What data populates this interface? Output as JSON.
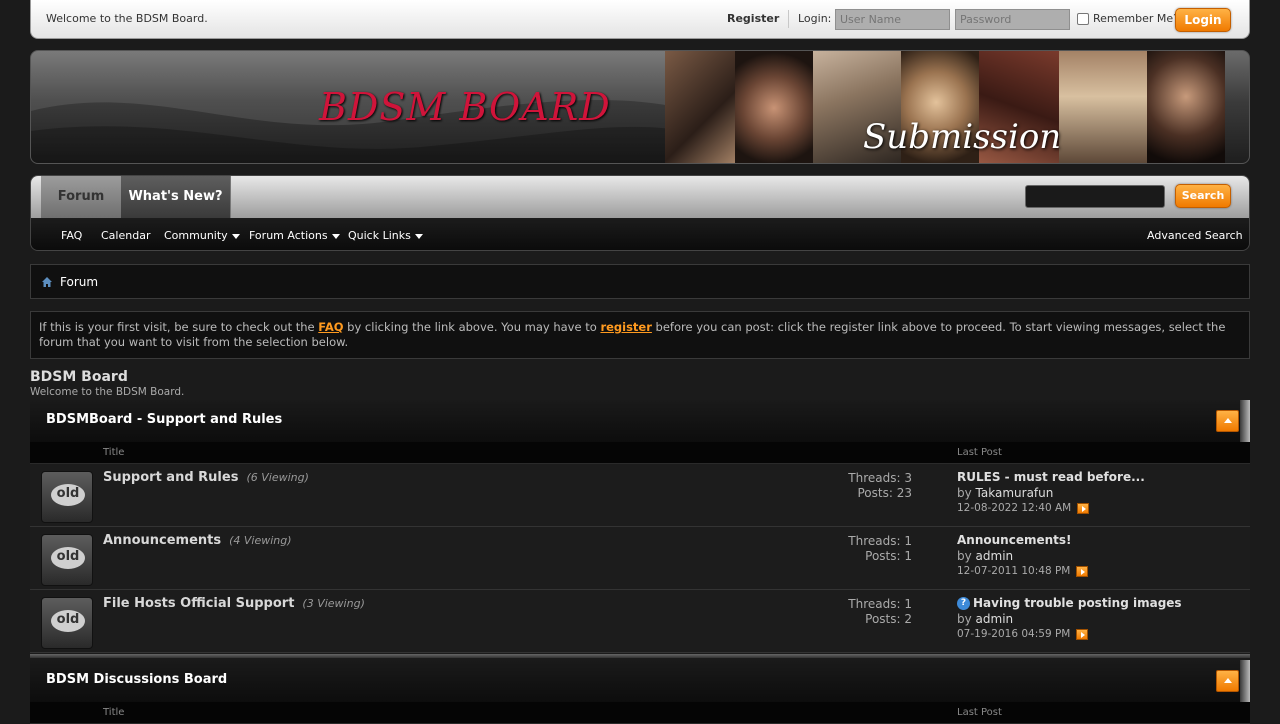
{
  "topbar": {
    "welcome": "Welcome to the BDSM Board.",
    "register": "Register",
    "login_label": "Login:",
    "username_placeholder": "User Name",
    "password_placeholder": "Password",
    "remember": "Remember Me?",
    "login_button": "Login"
  },
  "banner": {
    "logo": "BDSM BOARD",
    "tagline": "Submission"
  },
  "nav": {
    "tabs": [
      {
        "label": "Forum"
      },
      {
        "label": "What's New?"
      }
    ],
    "search_button": "Search",
    "sub": [
      {
        "label": "FAQ"
      },
      {
        "label": "Calendar"
      },
      {
        "label": "Community"
      },
      {
        "label": "Forum Actions"
      },
      {
        "label": "Quick Links"
      }
    ],
    "advanced_search": "Advanced Search"
  },
  "breadcrumb": {
    "current": "Forum"
  },
  "notice": {
    "part1": "If this is your first visit, be sure to check out the ",
    "faq_link": "FAQ",
    "part2": " by clicking the link above. You may have to ",
    "register_link": "register",
    "part3": " before you can post: click the register link above to proceed. To start viewing messages, select the forum that you want to visit from the selection below."
  },
  "board": {
    "name": "BDSM Board",
    "description": "Welcome to the BDSM Board."
  },
  "columns": {
    "title": "Title",
    "last_post": "Last Post"
  },
  "categories": [
    {
      "title": "BDSMBoard - Support and Rules",
      "forums": [
        {
          "icon_text": "old",
          "name": "Support and Rules",
          "viewing": "(6 Viewing)",
          "threads": "Threads: 3",
          "posts": "Posts: 23",
          "last_title": "RULES - must read before...",
          "last_by_prefix": "by ",
          "last_by": "Takamurafun",
          "last_date": "12-08-2022 12:40 AM"
        },
        {
          "icon_text": "old",
          "name": "Announcements",
          "viewing": "(4 Viewing)",
          "threads": "Threads: 1",
          "posts": "Posts: 1",
          "last_title": "Announcements!",
          "last_by_prefix": "by ",
          "last_by": "admin",
          "last_date": "12-07-2011 10:48 PM"
        },
        {
          "icon_text": "old",
          "name": "File Hosts Official Support",
          "viewing": "(3 Viewing)",
          "threads": "Threads: 1",
          "posts": "Posts: 2",
          "last_title": "Having trouble posting images",
          "last_by_prefix": "by ",
          "last_by": "admin",
          "last_date": "07-19-2016 04:59 PM"
        }
      ]
    },
    {
      "title": "BDSM Discussions Board"
    }
  ],
  "icons": {
    "home": "home-icon",
    "question": "question-icon",
    "goto": "goto-last-post-icon",
    "collapse": "collapse-icon"
  }
}
